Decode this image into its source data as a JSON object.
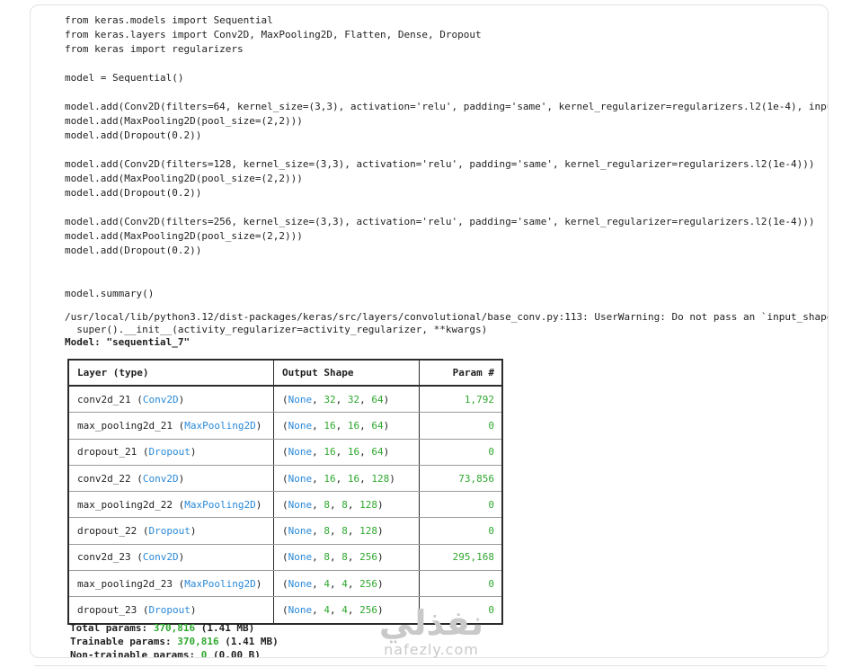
{
  "code_lines": [
    "from keras.models import Sequential",
    "from keras.layers import Conv2D, MaxPooling2D, Flatten, Dense, Dropout",
    "from keras import regularizers",
    "",
    "model = Sequential()",
    "",
    "model.add(Conv2D(filters=64, kernel_size=(3,3), activation='relu', padding='same', kernel_regularizer=regularizers.l2(1e-4), input_sh",
    "model.add(MaxPooling2D(pool_size=(2,2)))",
    "model.add(Dropout(0.2))",
    "",
    "model.add(Conv2D(filters=128, kernel_size=(3,3), activation='relu', padding='same', kernel_regularizer=regularizers.l2(1e-4)))",
    "model.add(MaxPooling2D(pool_size=(2,2)))",
    "model.add(Dropout(0.2))",
    "",
    "model.add(Conv2D(filters=256, kernel_size=(3,3), activation='relu', padding='same', kernel_regularizer=regularizers.l2(1e-4)))",
    "model.add(MaxPooling2D(pool_size=(2,2)))",
    "model.add(Dropout(0.2))",
    "",
    "",
    "model.summary()"
  ],
  "output": {
    "warning_line1": "/usr/local/lib/python3.12/dist-packages/keras/src/layers/convolutional/base_conv.py:113: UserWarning: Do not pass an `input_shape`/`",
    "warning_line2": "  super().__init__(activity_regularizer=activity_regularizer, **kwargs)",
    "model_title": "Model: \"sequential_7\"",
    "headers": {
      "layer": "Layer (type)",
      "shape": "Output Shape",
      "params": "Param #"
    },
    "rows": [
      {
        "name": "conv2d_21",
        "type": "Conv2D",
        "dims": "32, 32, 64",
        "params": "1,792"
      },
      {
        "name": "max_pooling2d_21",
        "type": "MaxPooling2D",
        "dims": "16, 16, 64",
        "params": "0"
      },
      {
        "name": "dropout_21",
        "type": "Dropout",
        "dims": "16, 16, 64",
        "params": "0"
      },
      {
        "name": "conv2d_22",
        "type": "Conv2D",
        "dims": "16, 16, 128",
        "params": "73,856"
      },
      {
        "name": "max_pooling2d_22",
        "type": "MaxPooling2D",
        "dims": "8, 8, 128",
        "params": "0"
      },
      {
        "name": "dropout_22",
        "type": "Dropout",
        "dims": "8, 8, 128",
        "params": "0"
      },
      {
        "name": "conv2d_23",
        "type": "Conv2D",
        "dims": "8, 8, 256",
        "params": "295,168"
      },
      {
        "name": "max_pooling2d_23",
        "type": "MaxPooling2D",
        "dims": "4, 4, 256",
        "params": "0"
      },
      {
        "name": "dropout_23",
        "type": "Dropout",
        "dims": "4, 4, 256",
        "params": "0"
      }
    ],
    "none_label": "None",
    "totals": {
      "total_label": "Total params: ",
      "total_value": "370,816",
      "total_size": " (1.41 MB)",
      "trainable_label": "Trainable params: ",
      "trainable_value": "370,816",
      "trainable_size": " (1.41 MB)",
      "nontrainable_label": "Non-trainable params: ",
      "nontrainable_value": "0",
      "nontrainable_size": " (0.00 B)"
    }
  },
  "watermark": {
    "arabic": "نفذلي",
    "latin": "nafezly.com"
  },
  "colors": {
    "class_name": "#2a89d8",
    "number": "#2fa82f",
    "border": "#2b2b2b"
  }
}
